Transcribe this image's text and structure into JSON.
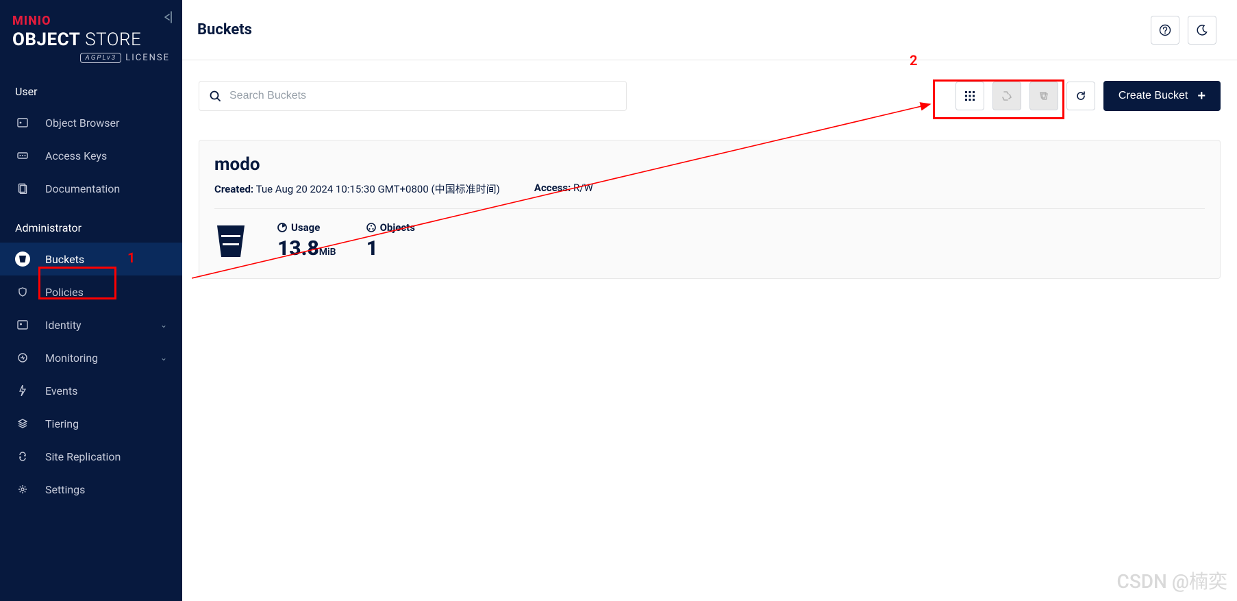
{
  "brand": {
    "top": "MINIO",
    "main_bold": "OBJECT",
    "main_light": "STORE",
    "badge": "AGPLv3",
    "license": "LICENSE"
  },
  "sidebar": {
    "section_user": "User",
    "section_admin": "Administrator",
    "user_items": [
      {
        "label": "Object Browser"
      },
      {
        "label": "Access Keys"
      },
      {
        "label": "Documentation"
      }
    ],
    "admin_items": [
      {
        "label": "Buckets",
        "active": true
      },
      {
        "label": "Policies"
      },
      {
        "label": "Identity",
        "expandable": true
      },
      {
        "label": "Monitoring",
        "expandable": true
      },
      {
        "label": "Events"
      },
      {
        "label": "Tiering"
      },
      {
        "label": "Site Replication"
      },
      {
        "label": "Settings"
      }
    ]
  },
  "header": {
    "title": "Buckets"
  },
  "search": {
    "placeholder": "Search Buckets"
  },
  "actions": {
    "create_label": "Create Bucket"
  },
  "bucket": {
    "name": "modo",
    "created_label": "Created:",
    "created_value": "Tue Aug 20 2024 10:15:30 GMT+0800 (中国标准时间)",
    "access_label": "Access:",
    "access_value": "R/W",
    "usage_label": "Usage",
    "usage_value": "13.8",
    "usage_unit": "MiB",
    "objects_label": "Objects",
    "objects_value": "1"
  },
  "annotations": {
    "label1": "1",
    "label2": "2"
  },
  "watermark": "CSDN @楠奕"
}
